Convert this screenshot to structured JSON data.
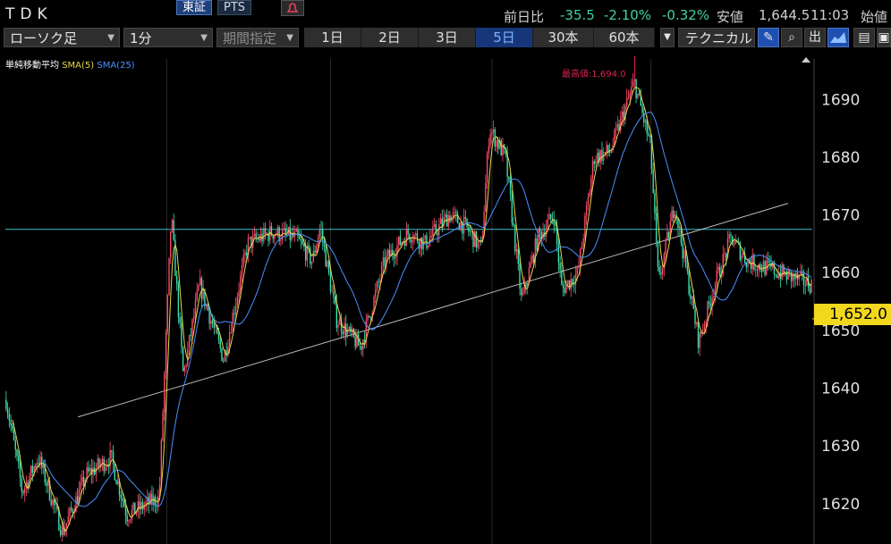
{
  "header": {
    "ticker": "TDK",
    "exchange_tabs": [
      "東証",
      "PTS"
    ],
    "change_label": "前日比",
    "change_value": "-35.5",
    "change_pct": "-2.10%",
    "change_pct2": "-0.32%",
    "low_label": "安値",
    "low_value": "1,644.5",
    "time": "11:03",
    "open_label": "始値"
  },
  "toolbar": {
    "chart_type": "ローソク足",
    "interval": "1分",
    "period_placeholder": "期間指定",
    "ranges": [
      "1日",
      "2日",
      "3日",
      "5日",
      "30本",
      "60本"
    ],
    "active_range": "5日",
    "technical": "テクニカル",
    "icons": [
      "pen-icon",
      "zoom-icon",
      "volume-icon",
      "chart-icon",
      "save-icon",
      "layout-icon"
    ]
  },
  "legend": {
    "title": "単純移動平均",
    "sma5": "SMA(5)",
    "sma25": "SMA(25)",
    "sma5_color": "#e8d84a",
    "sma25_color": "#4a90ff"
  },
  "chart_data": {
    "type": "candlestick",
    "y_ticks": [
      "1690",
      "1680",
      "1670",
      "1660",
      "1650",
      "1640",
      "1630",
      "1620"
    ],
    "ylim": [
      1613,
      1697
    ],
    "current_price": "1,652.0",
    "max_label": "最高値:1,694.0",
    "horizontal_line": 1667.5,
    "trend_line": [
      [
        0.09,
        1635
      ],
      [
        0.97,
        1672
      ]
    ],
    "key_points": [
      [
        0.0,
        1638
      ],
      [
        0.02,
        1622
      ],
      [
        0.04,
        1628
      ],
      [
        0.07,
        1615
      ],
      [
        0.1,
        1625
      ],
      [
        0.13,
        1628
      ],
      [
        0.15,
        1618
      ],
      [
        0.19,
        1621
      ],
      [
        0.205,
        1670
      ],
      [
        0.22,
        1642
      ],
      [
        0.24,
        1658
      ],
      [
        0.27,
        1645
      ],
      [
        0.3,
        1665
      ],
      [
        0.33,
        1667
      ],
      [
        0.36,
        1666
      ],
      [
        0.38,
        1662
      ],
      [
        0.39,
        1668
      ],
      [
        0.41,
        1652
      ],
      [
        0.44,
        1647
      ],
      [
        0.47,
        1662
      ],
      [
        0.5,
        1667
      ],
      [
        0.52,
        1665
      ],
      [
        0.55,
        1670
      ],
      [
        0.57,
        1668
      ],
      [
        0.59,
        1664
      ],
      [
        0.6,
        1685
      ],
      [
        0.62,
        1680
      ],
      [
        0.64,
        1655
      ],
      [
        0.66,
        1666
      ],
      [
        0.68,
        1670
      ],
      [
        0.69,
        1657
      ],
      [
        0.71,
        1660
      ],
      [
        0.73,
        1680
      ],
      [
        0.75,
        1681
      ],
      [
        0.78,
        1693
      ],
      [
        0.8,
        1682
      ],
      [
        0.81,
        1658
      ],
      [
        0.83,
        1672
      ],
      [
        0.86,
        1648
      ],
      [
        0.88,
        1658
      ],
      [
        0.9,
        1666
      ],
      [
        0.92,
        1662
      ],
      [
        1.0,
        1658
      ]
    ]
  }
}
